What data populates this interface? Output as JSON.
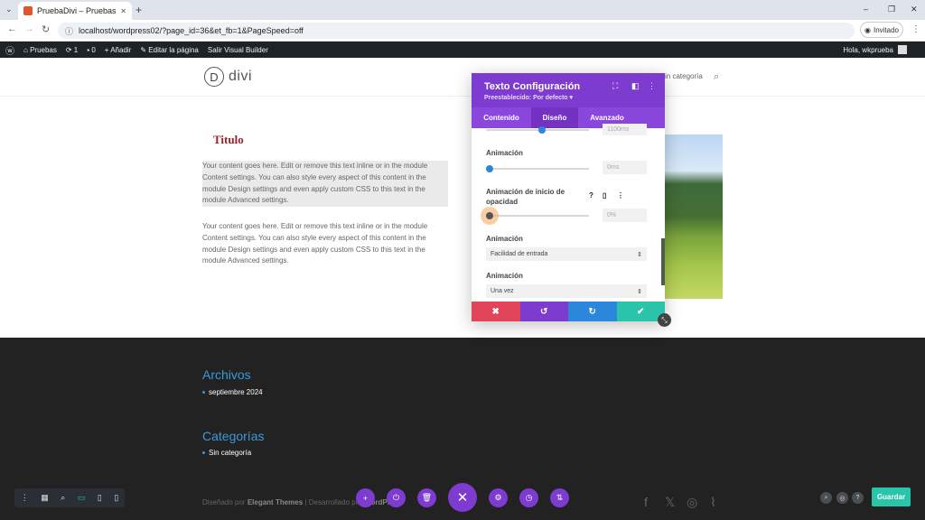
{
  "browser": {
    "tab_title": "PruebaDivi – Pruebas",
    "new_tab_icon": "+",
    "url": "localhost/wordpress02/?page_id=36&et_fb=1&PageSpeed=off",
    "profile_label": "Invitado",
    "window_controls": [
      "–",
      "❐",
      "✕"
    ]
  },
  "adminbar": {
    "site_name": "Pruebas",
    "updates_count": "1",
    "comments_count": "0",
    "add_new": "Añadir",
    "edit_page": "Editar la página",
    "exit_builder": "Salir Visual Builder",
    "greeting": "Hola, wkprueba"
  },
  "site": {
    "logo_letter": "D",
    "logo_text": "divi",
    "menu_item": "in categoría"
  },
  "content": {
    "title": "Titulo",
    "paragraph_1": "Your content goes here. Edit or remove this text inline or in the module Content settings. You can also style every aspect of this content in the module Design settings and even apply custom CSS to this text in the module Advanced settings.",
    "paragraph_2": "Your content goes here. Edit or remove this text inline or in the module Content settings. You can also style every aspect of this content in the module Design settings and even apply custom CSS to this text in the module Advanced settings."
  },
  "modal": {
    "title": "Texto Configuración",
    "preset": "Preestablecido: Por defecto ▾",
    "tabs": [
      {
        "label": "Contenido",
        "active": false
      },
      {
        "label": "Diseño",
        "active": true
      },
      {
        "label": "Avanzado",
        "active": false
      }
    ],
    "top_partial_value": "1100ms",
    "field_delay_label": "Animación",
    "field_delay_value": "0ms",
    "field_delay_level": 0,
    "field_opacity_label": "Animación de inicio de opacidad",
    "field_opacity_value": "0%",
    "field_opacity_level": 0,
    "field_easing_label": "Animación",
    "field_easing_value": "Facilidad de entrada",
    "field_repeat_label": "Animación",
    "field_repeat_value": "Una vez",
    "footer_colors": [
      "#e2455a",
      "#7e3bd0",
      "#2b87da",
      "#29c4a9"
    ]
  },
  "footer": {
    "archives_heading": "Archivos",
    "archives_item": "septiembre 2024",
    "categories_heading": "Categorías",
    "categories_item": "Sin categoría",
    "credit_prefix": "Diseñado por",
    "credit_brand": "Elegant Themes",
    "credit_mid": "| Desarrollado por",
    "credit_wp": "WordPress"
  },
  "builder": {
    "save_label": "Guardar"
  }
}
